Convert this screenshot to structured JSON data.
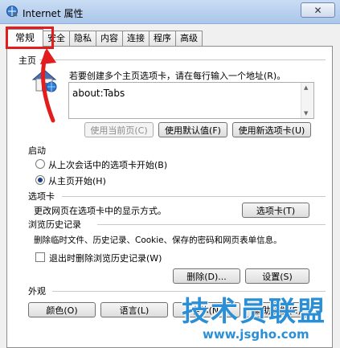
{
  "window": {
    "title": "Internet 属性",
    "close_label": "✕"
  },
  "tabs": [
    "常规",
    "安全",
    "隐私",
    "内容",
    "连接",
    "程序",
    "高级"
  ],
  "homepage": {
    "section_title": "主页",
    "description": "若要创建多个主页选项卡，请在每行输入一个地址(R)。",
    "url_value": "about:Tabs",
    "buttons": {
      "use_current": "使用当前页(C)",
      "use_default": "使用默认值(F)",
      "use_new_tab": "使用新选项卡(U)"
    }
  },
  "startup": {
    "section_title": "启动",
    "option_last_session": "从上次会话中的选项卡开始(B)",
    "option_homepage": "从主页开始(H)",
    "selected": "option_homepage"
  },
  "tabs_section": {
    "section_title": "选项卡",
    "description": "更改网页在选项卡中的显示方式。",
    "button": "选项卡(T)"
  },
  "history": {
    "section_title": "浏览历史记录",
    "description": "删除临时文件、历史记录、Cookie、保存的密码和网页表单信息。",
    "checkbox_label": "退出时删除浏览历史记录(W)",
    "checkbox_checked": false,
    "delete_button": "删除(D)...",
    "settings_button": "设置(S)"
  },
  "appearance": {
    "section_title": "外观",
    "colors_button": "颜色(O)",
    "languages_button": "语言(L)",
    "fonts_button": "字体(N)",
    "accessibility_button": "辅助功能(E)"
  },
  "watermark": {
    "title": "技术员联盟",
    "url": "www.jsgho.com"
  },
  "colors": {
    "accent": "#2a8fd6",
    "annotation": "#e21d1d"
  }
}
